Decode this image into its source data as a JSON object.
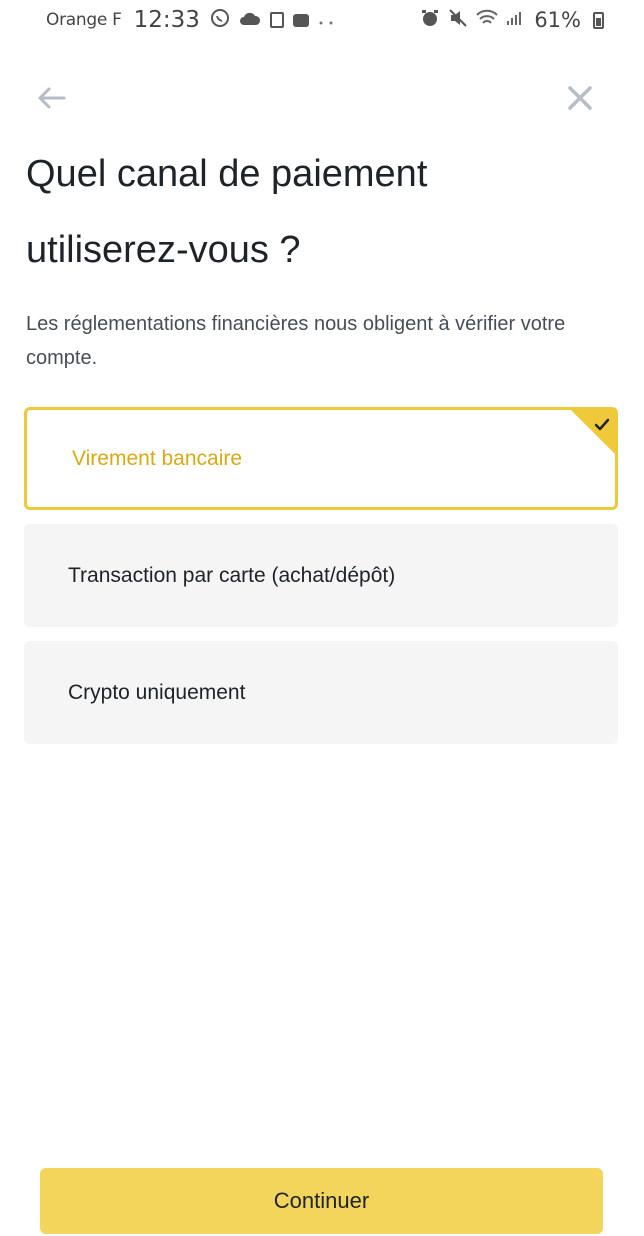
{
  "status_bar": {
    "carrier": "Orange F",
    "time": "12:33",
    "battery": "61%"
  },
  "page": {
    "title": "Quel canal de paiement utiliserez-vous ?",
    "subtitle": "Les réglementations financières nous obligent à vérifier votre compte."
  },
  "options": [
    {
      "label": "Virement bancaire",
      "selected": true
    },
    {
      "label": "Transaction par carte (achat/dépôt)",
      "selected": false
    },
    {
      "label": "Crypto uniquement",
      "selected": false
    }
  ],
  "footer": {
    "continue_label": "Continuer"
  },
  "colors": {
    "accent": "#f0c93a",
    "accent_text": "#d9a914",
    "button": "#f3d55b",
    "option_bg": "#f5f5f5"
  },
  "icons": {
    "back": "arrow-left-icon",
    "close": "close-icon",
    "selected_marker": "checkmark-icon"
  }
}
